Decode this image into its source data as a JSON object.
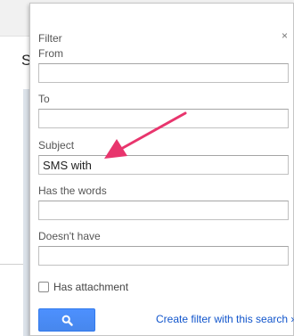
{
  "filter": {
    "title": "Filter",
    "close_glyph": "×",
    "from": {
      "label": "From",
      "value": ""
    },
    "to": {
      "label": "To",
      "value": ""
    },
    "subject": {
      "label": "Subject",
      "value": "SMS with"
    },
    "has_words": {
      "label": "Has the words",
      "value": ""
    },
    "doesnt_have": {
      "label": "Doesn't have",
      "value": ""
    },
    "has_attachment": {
      "label": "Has attachment",
      "checked": false
    },
    "search_button": {
      "icon": "magnifier-icon"
    },
    "create_filter_link": "Create filter with this search »"
  },
  "background": {
    "partial_letter": "S"
  },
  "annotation": {
    "color": "#e8356d"
  },
  "colors": {
    "accent": "#4d90fe",
    "link": "#1155cc"
  }
}
